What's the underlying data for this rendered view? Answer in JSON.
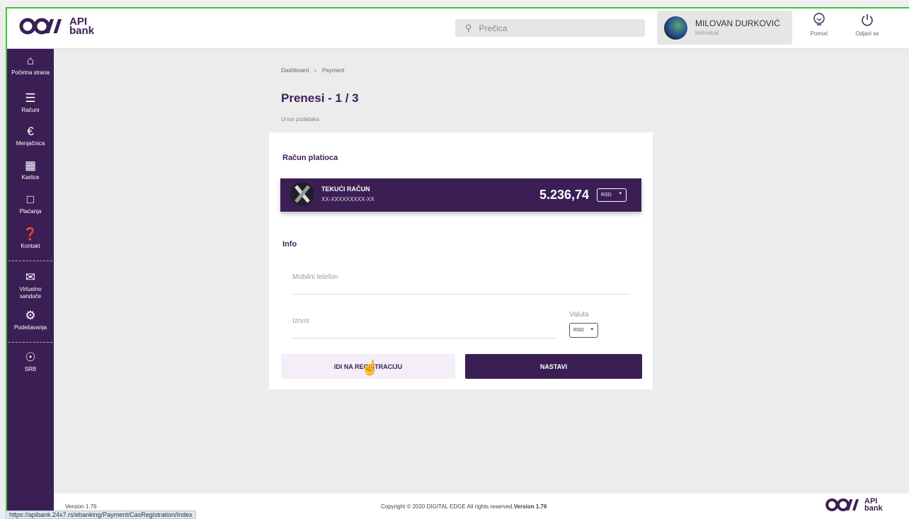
{
  "header": {
    "logo_word1": "API",
    "logo_word2": "bank",
    "search_placeholder": "Prečica",
    "user_name": "MILOVAN DURKOVIĆ",
    "user_type": "individual",
    "help_label": "Pomoć",
    "logout_label": "Odjavi se"
  },
  "sidebar": {
    "items": [
      {
        "label": "Početna strana",
        "icon": "home-icon"
      },
      {
        "label": "Računi",
        "icon": "list-icon"
      },
      {
        "label": "Menjačnica",
        "icon": "exchange-icon"
      },
      {
        "label": "Kartice",
        "icon": "card-icon"
      },
      {
        "label": "Plaćanja",
        "icon": "wallet-icon"
      },
      {
        "label": "Kontakt",
        "icon": "chat-icon"
      },
      {
        "label": "Virtuelno sanduče",
        "icon": "mail-icon"
      },
      {
        "label": "Podešavanja",
        "icon": "gear-icon"
      },
      {
        "label": "SRB",
        "icon": "globe-icon"
      }
    ]
  },
  "breadcrumb": {
    "parent": "Dashboard",
    "separator": "›",
    "current": "Payment"
  },
  "page": {
    "title": "Prenesi - 1 / 3",
    "subtitle": "Unos podataka"
  },
  "payer": {
    "section_title": "Račun platioca",
    "account_name": "TEKUĆI RAČUN",
    "account_number": "XX-XXXXXXXXX-XX",
    "balance": "5.236,74",
    "currency": "RSD"
  },
  "info": {
    "section_title": "Info",
    "phone_placeholder": "Mobilni telefon",
    "amount_placeholder": "Iznos",
    "currency_label": "Valuta",
    "currency_value": "RSD"
  },
  "actions": {
    "register_label": "IDI NA REGISTRACIJU",
    "continue_label": "NASTAVI"
  },
  "footer": {
    "version": "Version 1.76",
    "copyright": "Copyright © 2020 DIGITAL EDGE All rights reserved.",
    "copyright_version": "Version 1.76",
    "logo_word1": "API",
    "logo_word2": "bank"
  },
  "statusbar": {
    "url": "https://apibank.24x7.rs/ebanking/Payment/CasRegistration/Index"
  },
  "colors": {
    "brand_purple": "#3b1f54",
    "background": "#ececec",
    "accent_green": "#3ec43e"
  }
}
